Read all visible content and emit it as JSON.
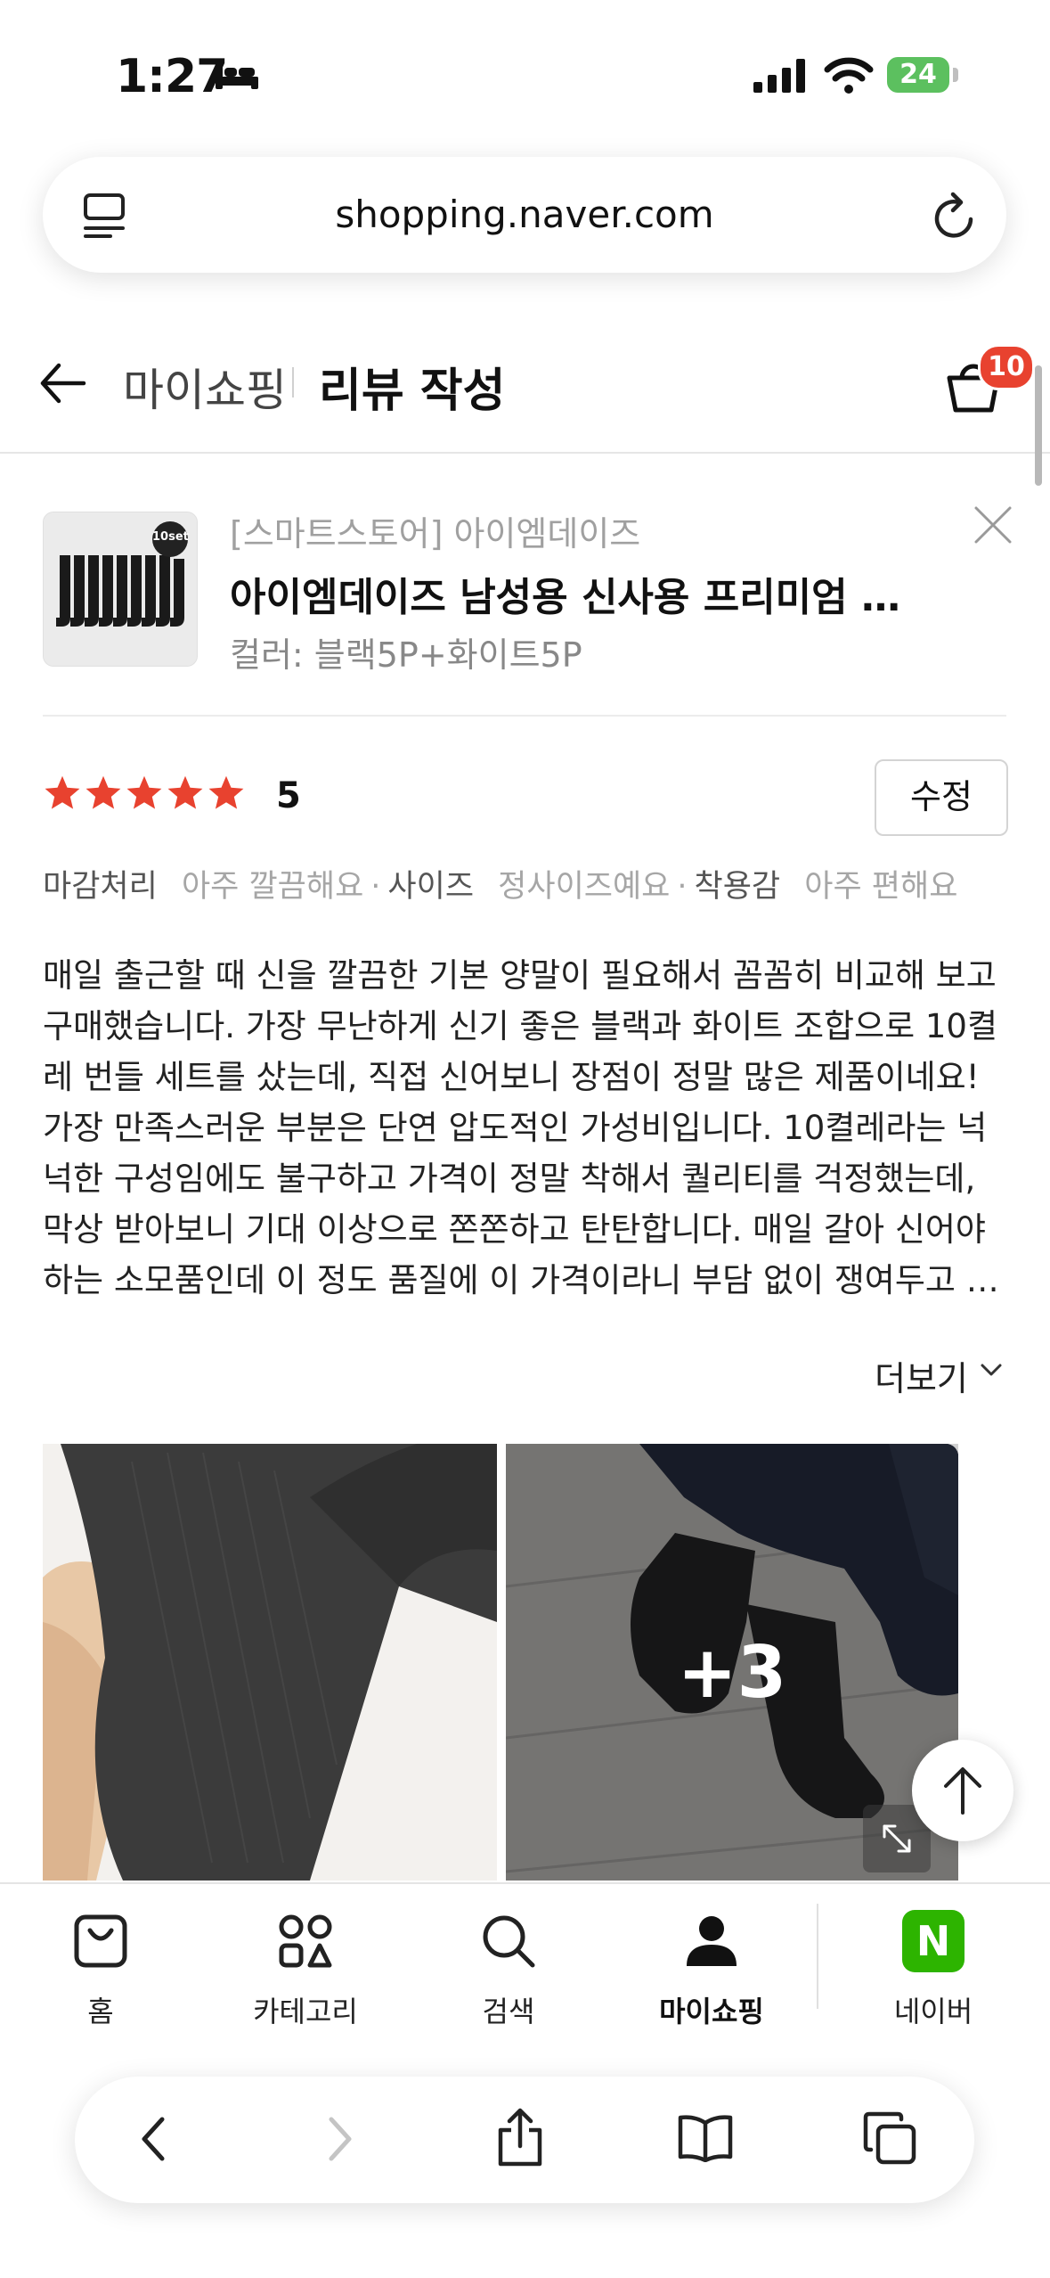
{
  "status_bar": {
    "time": "1:27",
    "battery": "24"
  },
  "browser": {
    "url": "shopping.naver.com"
  },
  "header": {
    "breadcrumb": "마이쇼핑",
    "title": "리뷰 작성",
    "cart_badge": "10"
  },
  "product": {
    "store": "[스마트스토어] 아이엠데이즈",
    "name": "아이엠데이즈 남성용 신사용 프리미엄 장…",
    "option": "컬러: 블랙5P+화이트5P",
    "thumb_badge": "10set"
  },
  "review": {
    "rating": "5",
    "rating_value": 5,
    "edit_label": "수정",
    "attributes": [
      {
        "key": "마감처리",
        "value": "아주 깔끔해요"
      },
      {
        "key": "사이즈",
        "value": "정사이즈예요"
      },
      {
        "key": "착용감",
        "value": "아주 편해요"
      }
    ],
    "attr_separator": "·",
    "body_lines": [
      "매일 출근할 때 신을 깔끔한 기본 양말이 필요해서 꼼꼼히 비교해 보고",
      "구매했습니다. 가장 무난하게 신기 좋은 블랙과 화이트 조합으로 10켤",
      "레 번들 세트를 샀는데, 직접 신어보니 장점이 정말 많은 제품이네요!",
      "가장 만족스러운 부분은 단연 압도적인 가성비입니다. 10켤레라는 넉",
      "넉한 구성임에도 불구하고 가격이 정말 착해서 퀄리티를 걱정했는데,",
      "막상 받아보니 기대 이상으로 쫀쫀하고 탄탄합니다. 매일 갈아 신어야",
      "하는 소모품인데 이 정도 품질에 이 가격이라니 부담 없이 쟁여두고 …"
    ],
    "more_label": "더보기",
    "photo_more": "+3"
  },
  "tabs": [
    {
      "label": "홈",
      "icon": "shopping-bag-icon"
    },
    {
      "label": "카테고리",
      "icon": "category-grid-icon"
    },
    {
      "label": "검색",
      "icon": "search-icon"
    },
    {
      "label": "마이쇼핑",
      "icon": "person-icon",
      "active": true
    },
    {
      "label": "네이버",
      "icon": "naver-logo-icon"
    }
  ],
  "naver_logo_letter": "N",
  "colors": {
    "star": "#e8422f",
    "badge": "#e8422f",
    "naver_green": "#2db400",
    "battery": "#5cc05f"
  }
}
